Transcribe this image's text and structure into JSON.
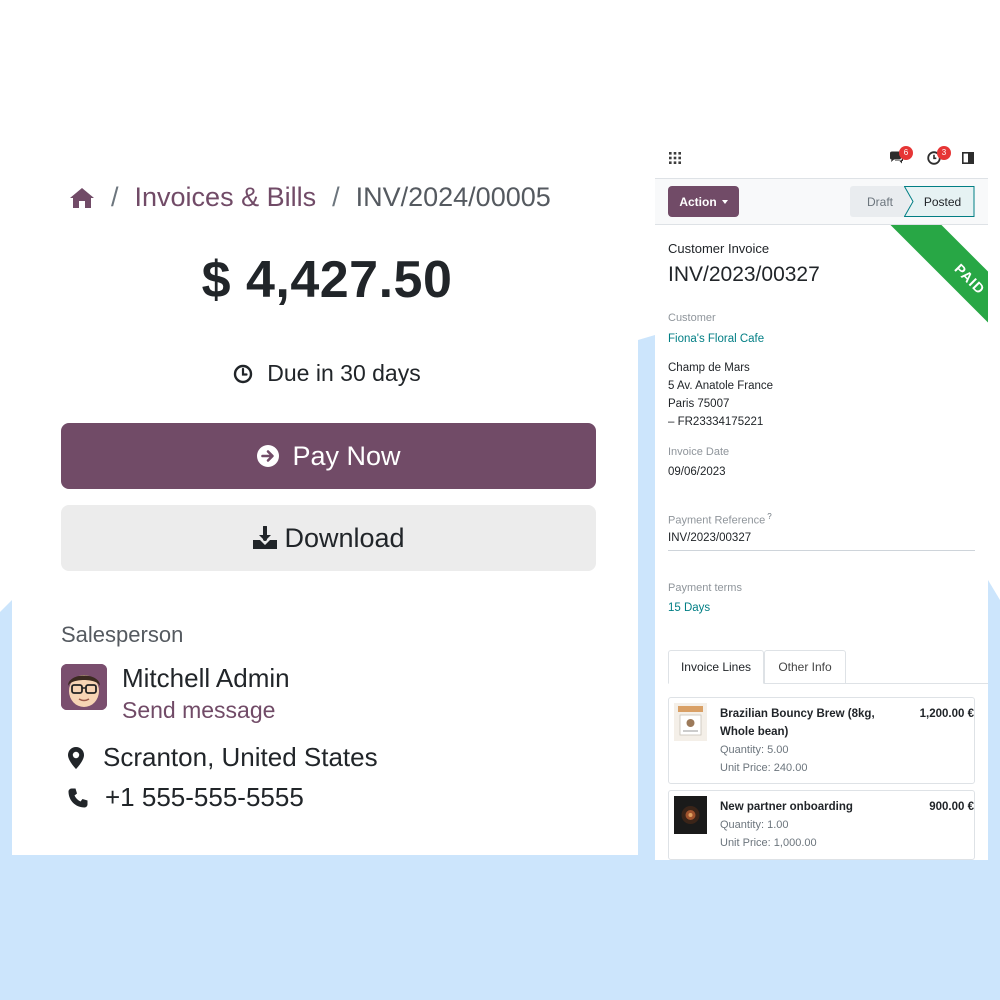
{
  "portal": {
    "breadcrumb": {
      "home_icon": "home-icon",
      "separator": "/",
      "link": "Invoices & Bills",
      "current": "INV/2024/00005"
    },
    "amount": "$ 4,427.50",
    "due_text": "Due in 30 days",
    "pay_button": "Pay Now",
    "download_button": "Download",
    "salesperson": {
      "title": "Salesperson",
      "name": "Mitchell Admin",
      "send_message": "Send message",
      "location": "Scranton, United States",
      "phone": "+1 555-555-5555"
    }
  },
  "backend": {
    "topbar": {
      "messages_count": "6",
      "activities_count": "3"
    },
    "action_button": "Action",
    "status": {
      "draft": "Draft",
      "posted": "Posted",
      "current": "posted"
    },
    "ribbon": "PAID",
    "doc_type": "Customer Invoice",
    "doc_name": "INV/2023/00327",
    "customer": {
      "label": "Customer",
      "name": "Fiona's Floral Cafe",
      "address_lines": [
        "Champ de Mars",
        "5 Av. Anatole France",
        "Paris 75007",
        "– FR23334175221"
      ]
    },
    "invoice_date": {
      "label": "Invoice Date",
      "value": "09/06/2023"
    },
    "payment_reference": {
      "label": "Payment Reference",
      "help": "?",
      "value": "INV/2023/00327"
    },
    "payment_terms": {
      "label": "Payment terms",
      "value": "15 Days"
    },
    "tabs": [
      "Invoice Lines",
      "Other Info"
    ],
    "lines": [
      {
        "name_line1": "Brazilian Bouncy Brew (8kg,",
        "name_line2": "Whole bean)",
        "price": "1,200.00 €",
        "quantity": "Quantity: 5.00",
        "unit_price": "Unit Price: 240.00"
      },
      {
        "name_line1": "New partner onboarding",
        "price": "900.00 €",
        "quantity": "Quantity: 1.00",
        "unit_price": "Unit Price: 1,000.00"
      }
    ]
  },
  "colors": {
    "brand": "#714b67",
    "link_teal": "#017e84",
    "paid_green": "#28a745",
    "background_blue": "#cce5fc"
  }
}
